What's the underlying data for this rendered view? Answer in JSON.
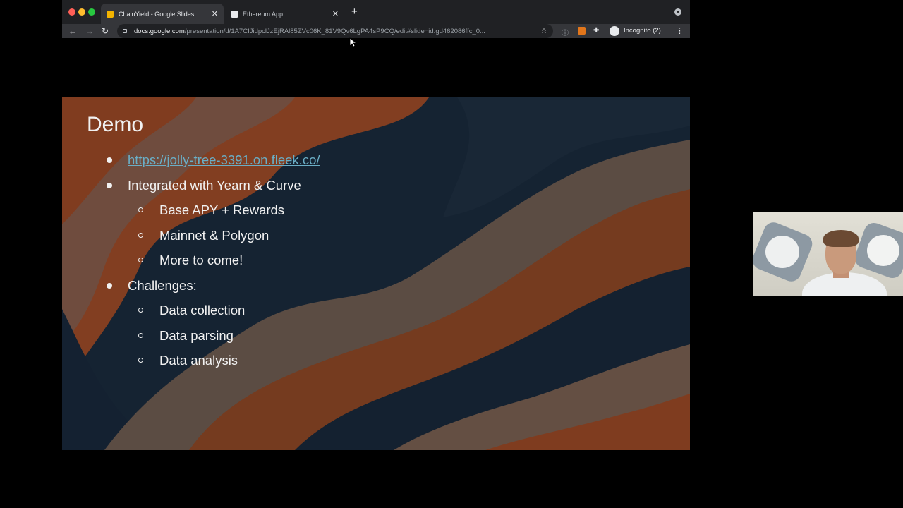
{
  "browser": {
    "tabs": [
      {
        "title": "ChainYield - Google Slides",
        "active": true,
        "favicon": "slides-icon"
      },
      {
        "title": "Ethereum App",
        "active": false,
        "favicon": "document-icon"
      }
    ],
    "new_tab_label": "+",
    "url_host": "docs.google.com",
    "url_path": "/presentation/d/1A7CIJidpclJzEjRAl85ZVc06K_81V9Qv6LgPA4sP9CQ/edit#slide=id.gd462086ffc_0...",
    "profile_label": "Incognito (2)"
  },
  "slide": {
    "title": "Demo",
    "items": [
      {
        "level": 1,
        "text": "https://jolly-tree-3391.on.fleek.co/",
        "is_link": true
      },
      {
        "level": 1,
        "text": "Integrated with Yearn & Curve"
      },
      {
        "level": 2,
        "text": "Base APY + Rewards"
      },
      {
        "level": 2,
        "text": "Mainnet & Polygon"
      },
      {
        "level": 2,
        "text": "More to come!"
      },
      {
        "level": 1,
        "text": "Challenges:"
      },
      {
        "level": 2,
        "text": "Data collection"
      },
      {
        "level": 2,
        "text": "Data parsing"
      },
      {
        "level": 2,
        "text": "Data analysis"
      }
    ],
    "colors": {
      "orange": "#b4572e",
      "navy": "#1c2f44",
      "tan": "#8a7260",
      "link": "#6aaec6"
    }
  }
}
